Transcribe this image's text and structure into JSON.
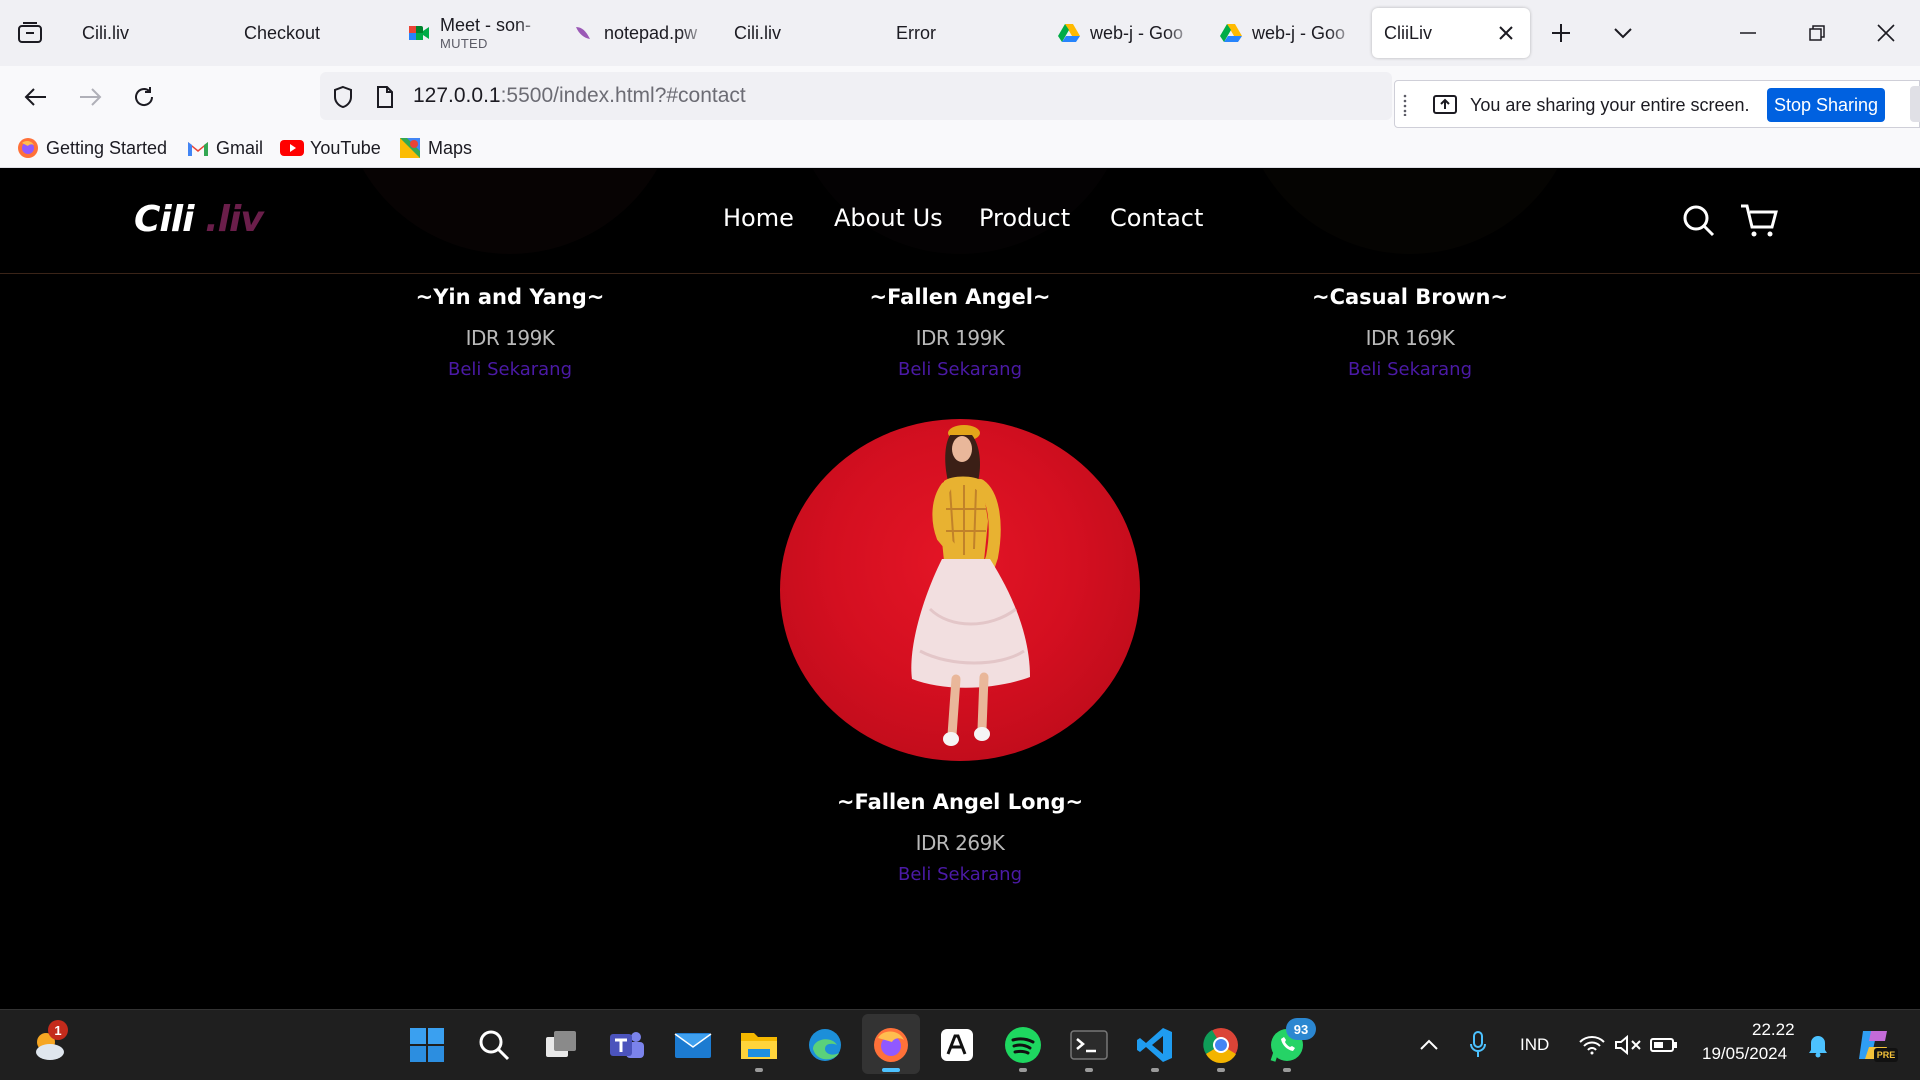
{
  "browser": {
    "tabs": [
      {
        "title": "Cili.liv",
        "sub": ""
      },
      {
        "title": "Checkout",
        "sub": ""
      },
      {
        "title": "Meet - son-",
        "sub": "MUTED"
      },
      {
        "title": "notepad.pw",
        "sub": ""
      },
      {
        "title": "Cili.liv",
        "sub": ""
      },
      {
        "title": "Error",
        "sub": ""
      },
      {
        "title": "web-j - Goo",
        "sub": ""
      },
      {
        "title": "web-j - Goo",
        "sub": ""
      },
      {
        "title": "CliiLiv",
        "sub": ""
      }
    ],
    "url_host": "127.0.0.1",
    "url_rest": ":5500/index.html?#contact",
    "share_message": "You are sharing your entire screen.",
    "stop_sharing_label": "Stop Sharing",
    "bookmarks": [
      "Getting Started",
      "Gmail",
      "YouTube",
      "Maps"
    ]
  },
  "site": {
    "logo_main": "Cili",
    "logo_accent": " .liv",
    "menu": [
      "Home",
      "About Us",
      "Product",
      "Contact"
    ],
    "products": [
      {
        "name": "~Yin and Yang~",
        "price": "IDR 199K",
        "cta": "Beli Sekarang"
      },
      {
        "name": "~Fallen Angel~",
        "price": "IDR 199K",
        "cta": "Beli Sekarang"
      },
      {
        "name": "~Casual Brown~",
        "price": "IDR 169K",
        "cta": "Beli Sekarang"
      },
      {
        "name": "~Fallen Angel Long~",
        "price": "IDR 269K",
        "cta": "Beli Sekarang"
      }
    ],
    "colors": {
      "accent_logo": "#6a1e4a",
      "buy_link": "#4b1aa6",
      "feature_bg": "#d40f20"
    }
  },
  "taskbar": {
    "weather_badge": "1",
    "whatsapp_badge": "93",
    "language": "IND",
    "time": "22.22",
    "date": "19/05/2024",
    "copilot_badge": "PRE"
  }
}
